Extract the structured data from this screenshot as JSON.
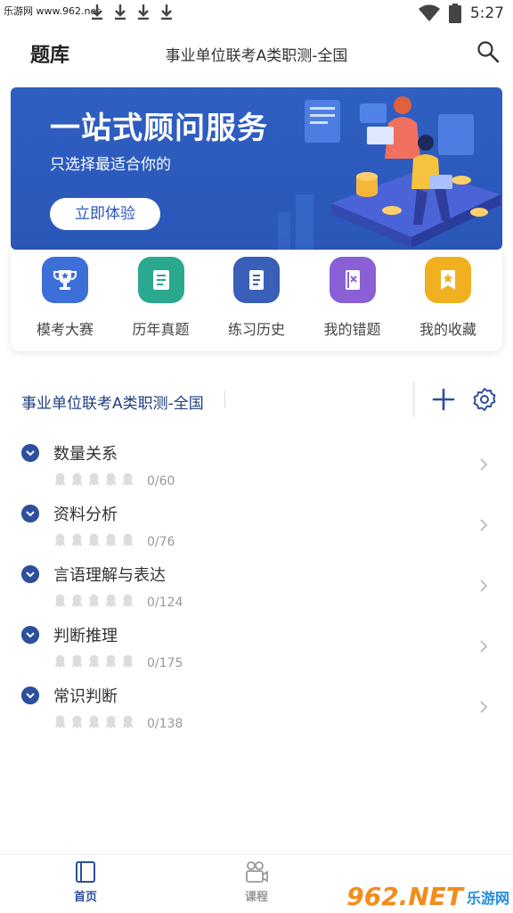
{
  "status_bar": {
    "watermark": "乐游网 www.962.net",
    "time": "5:27"
  },
  "header": {
    "title": "题库",
    "subject": "事业单位联考A类职测-全国",
    "search_icon": "search-icon"
  },
  "banner": {
    "title": "一站式顾问服务",
    "subtitle": "只选择最适合你的",
    "button_label": "立即体验"
  },
  "quick_menu": {
    "items": [
      {
        "label": "模考大赛",
        "icon": "trophy-icon",
        "color": "#3d6fd8"
      },
      {
        "label": "历年真题",
        "icon": "scroll-icon",
        "color": "#2aa98f"
      },
      {
        "label": "练习历史",
        "icon": "book-icon",
        "color": "#3a5fb8"
      },
      {
        "label": "我的错题",
        "icon": "notebook-x-icon",
        "color": "#8b5fd6"
      },
      {
        "label": "我的收藏",
        "icon": "bookmark-star-icon",
        "color": "#f0b020"
      }
    ]
  },
  "subject_bar": {
    "name": "事业单位联考A类职测-全国"
  },
  "categories": [
    {
      "name": "数量关系",
      "progress": "0/60"
    },
    {
      "name": "资料分析",
      "progress": "0/76"
    },
    {
      "name": "言语理解与表达",
      "progress": "0/124"
    },
    {
      "name": "判断推理",
      "progress": "0/175"
    },
    {
      "name": "常识判断",
      "progress": "0/138"
    }
  ],
  "bottom_nav": {
    "items": [
      {
        "label": "首页",
        "icon": "book-tab-icon",
        "active": true
      },
      {
        "label": "课程",
        "icon": "video-camera-icon",
        "active": false
      }
    ],
    "watermark_brand": "962.NET",
    "watermark_site": "乐游网"
  },
  "colors": {
    "primary": "#2d4f9c",
    "banner": "#2f5fc2",
    "text_muted": "#999999"
  }
}
